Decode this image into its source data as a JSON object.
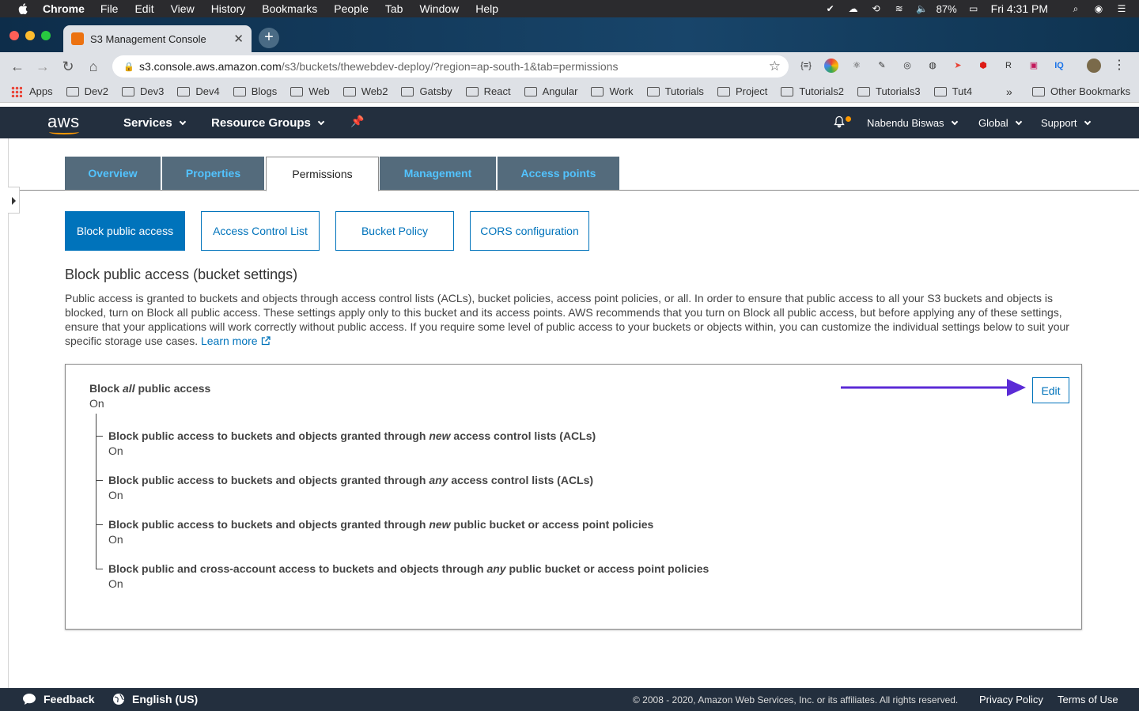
{
  "macos_menubar": {
    "app": "Chrome",
    "menus": [
      "File",
      "Edit",
      "View",
      "History",
      "Bookmarks",
      "People",
      "Tab",
      "Window",
      "Help"
    ],
    "battery": "87%",
    "clock": "Fri 4:31 PM"
  },
  "browser": {
    "tab_title": "S3 Management Console",
    "url_host": "s3.console.aws.amazon.com",
    "url_path": "/s3/buckets/thewebdev-deploy/?region=ap-south-1&tab=permissions",
    "bookmarks": [
      "Apps",
      "Dev2",
      "Dev3",
      "Dev4",
      "Blogs",
      "Web",
      "Web2",
      "Gatsby",
      "React",
      "Angular",
      "Work",
      "Tutorials",
      "Project",
      "Tutorials2",
      "Tutorials3",
      "Tut4"
    ],
    "more": "»",
    "other_bookmarks": "Other Bookmarks"
  },
  "aws_header": {
    "logo": "aws",
    "services": "Services",
    "resource_groups": "Resource Groups",
    "user": "Nabendu Biswas",
    "region": "Global",
    "support": "Support"
  },
  "tabs": [
    "Overview",
    "Properties",
    "Permissions",
    "Management",
    "Access points"
  ],
  "sub_tabs": [
    "Block public access",
    "Access Control List",
    "Bucket Policy",
    "CORS configuration"
  ],
  "section": {
    "title": "Block public access (bucket settings)",
    "description": "Public access is granted to buckets and objects through access control lists (ACLs), bucket policies, access point policies, or all. In order to ensure that public access to all your S3 buckets and objects is blocked, turn on Block all public access. These settings apply only to this bucket and its access points. AWS recommends that you turn on Block all public access, but before applying any of these settings, ensure that your applications will work correctly without public access. If you require some level of public access to your buckets or objects within, you can customize the individual settings below to suit your specific storage use cases.",
    "learn_more": "Learn more"
  },
  "settings": {
    "main": {
      "pre": "Block ",
      "em": "all",
      "post": " public access",
      "value": "On"
    },
    "items": [
      {
        "pre": "Block public access to buckets and objects granted through ",
        "em": "new",
        "post": " access control lists (ACLs)",
        "value": "On"
      },
      {
        "pre": "Block public access to buckets and objects granted through ",
        "em": "any",
        "post": " access control lists (ACLs)",
        "value": "On"
      },
      {
        "pre": "Block public access to buckets and objects granted through ",
        "em": "new",
        "post": " public bucket or access point policies",
        "value": "On"
      },
      {
        "pre": "Block public and cross-account access to buckets and objects through ",
        "em": "any",
        "post": " public bucket or access point policies",
        "value": "On"
      }
    ],
    "edit_label": "Edit"
  },
  "footer": {
    "feedback": "Feedback",
    "language": "English (US)",
    "copyright": "© 2008 - 2020, Amazon Web Services, Inc. or its affiliates. All rights reserved.",
    "privacy": "Privacy Policy",
    "terms": "Terms of Use"
  },
  "colors": {
    "aws_header": "#232f3e",
    "aws_orange": "#ff9900",
    "link_blue": "#0073bb",
    "tab_inactive": "#546b7c",
    "tab_text": "#52c3ff",
    "annotation_arrow": "#5b2bd6"
  }
}
